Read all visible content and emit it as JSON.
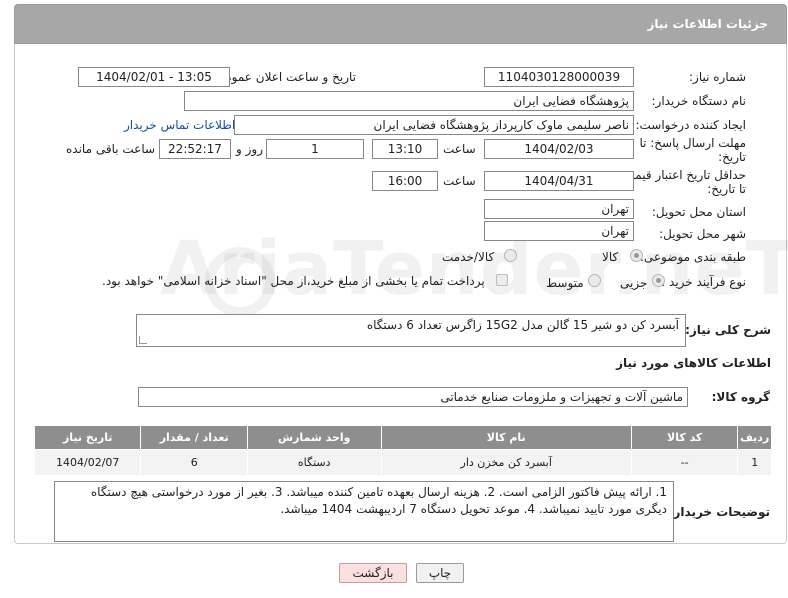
{
  "panel": {
    "title": "جزئیات اطلاعات نیاز"
  },
  "fields": {
    "need_number_label": "شماره نیاز:",
    "need_number": "1104030128000039",
    "announce_label": "تاریخ و ساعت اعلان عمومی:",
    "announce_value": "1404/02/01 - 13:05",
    "buyer_label": "نام دستگاه خریدار:",
    "buyer_value": "پژوهشگاه فضایی ایران",
    "creator_label": "ایجاد کننده درخواست:",
    "creator_value": "ناصر سلیمی ماوک کارپرداز پژوهشگاه فضایی ایران",
    "contact_link": "اطلاعات تماس خریدار",
    "deadline_label_1": "مهلت ارسال پاسخ: تا",
    "deadline_label_2": "تاریخ:",
    "deadline_date": "1404/02/03",
    "time_label": "ساعت",
    "deadline_time": "13:10",
    "days_value": "1",
    "days_label": "روز و",
    "remaining_value": "22:52:17",
    "remaining_label": "ساعت باقی مانده",
    "validity_label_1": "حداقل تاریخ اعتبار قیمت:",
    "validity_label_2": "تا تاریخ:",
    "validity_date": "1404/04/31",
    "validity_time": "16:00",
    "province_label": "استان محل تحویل:",
    "province_value": "تهران",
    "city_label": "شهر محل تحویل:",
    "city_value": "تهران",
    "category_label": "طبقه بندی موضوعی:",
    "category_options": [
      "کالا",
      "کالا/خدمت"
    ],
    "purchase_label": "نوع فرآیند خرید :",
    "purchase_options": [
      "جزیی",
      "متوسط"
    ],
    "payment_note": "پرداخت تمام یا بخشی از مبلغ خرید،از محل \"اسناد خزانه اسلامی\" خواهد بود."
  },
  "description": {
    "label": "شرح کلی نیاز:",
    "value": "آبسرد کن دو شیر 15 گالن مدل 15G2 زاگرس تعداد 6 دستگاه"
  },
  "goods_section": {
    "title": "اطلاعات کالاهای مورد نیاز",
    "group_label": "گروه کالا:",
    "group_value": "ماشین آلات و تجهیزات و ملزومات صنایع خدماتی"
  },
  "table": {
    "headers": [
      "ردیف",
      "کد کالا",
      "نام کالا",
      "واحد شمارش",
      "تعداد / مقدار",
      "تاریخ نیاز"
    ],
    "rows": [
      [
        "1",
        "--",
        "آبسرد کن مخزن دار",
        "دستگاه",
        "6",
        "1404/02/07"
      ]
    ]
  },
  "buyer_notes": {
    "label": "توضیحات خریدار:",
    "value": "1. ارائه پیش فاکتور الزامی است. 2. هزینه ارسال بعهده تامین کننده میباشد. 3. بغیر از مورد درخواستی هیچ دستگاه دیگری مورد تایید نمیباشد. 4. موعد تحویل دستگاه 7 اردیبهشت 1404 میباشد."
  },
  "buttons": {
    "print": "چاپ",
    "back": "بازگشت"
  },
  "watermark": {
    "text": "AriaTender.neT"
  },
  "colors": {
    "header": "#a7a7a7",
    "table_header": "#8e8e8e",
    "link": "#1a4fa0",
    "back_button": "#fbe0e0"
  }
}
